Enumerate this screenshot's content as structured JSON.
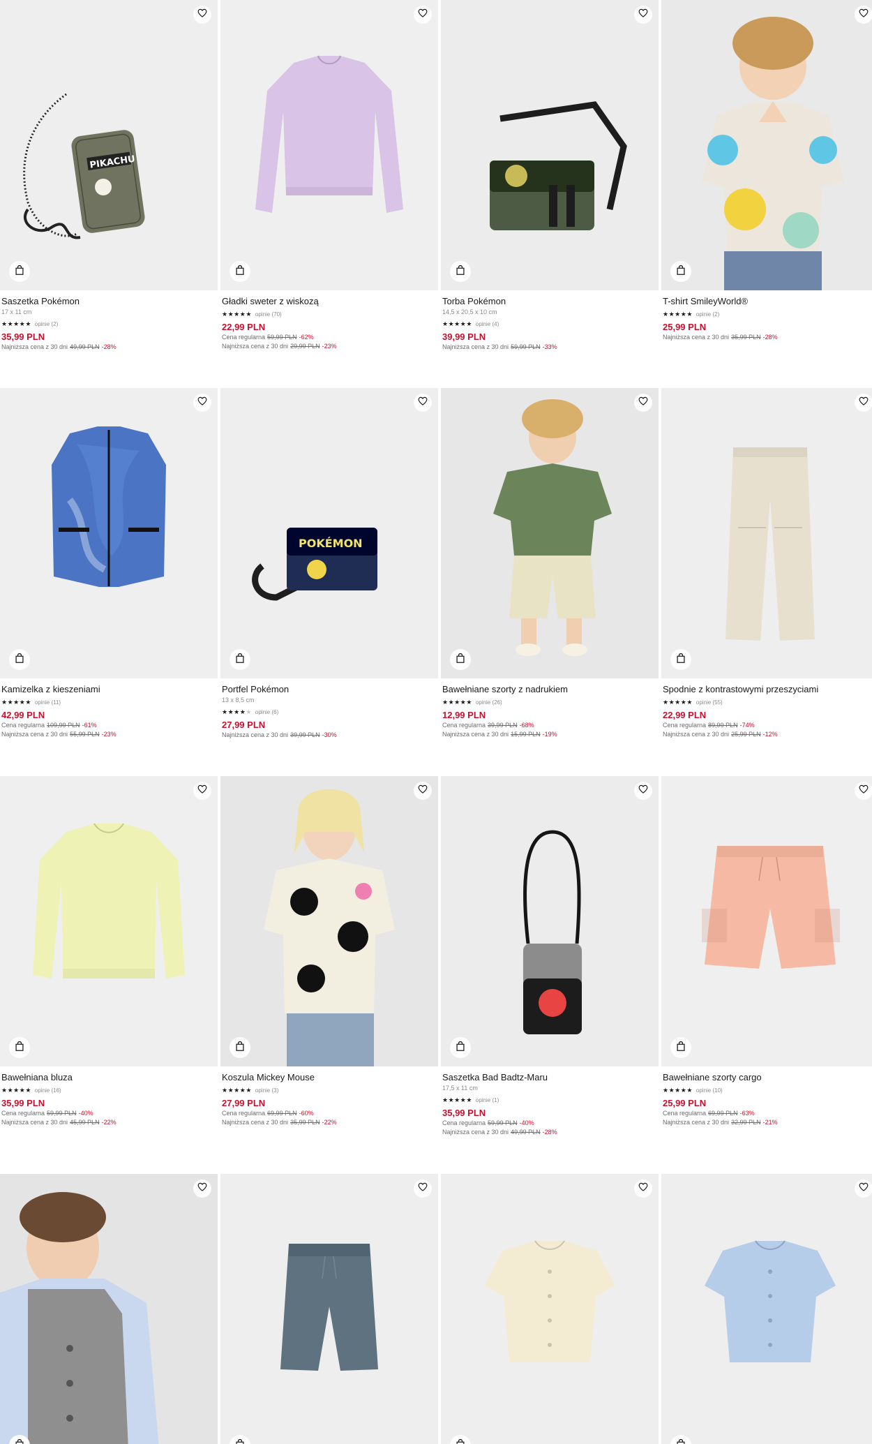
{
  "products": [
    {
      "name": "Saszetka Pokémon",
      "dims": "17 x 11 cm",
      "stars": 5,
      "reviews": "opinie (2)",
      "price": "35,99 PLN",
      "regular": null,
      "lowest": {
        "label": "Najniższa cena z 30 dni",
        "old": "49,99 PLN",
        "pct": "-28%"
      },
      "image": {
        "kind": "pouch",
        "bg": "#eeeeee",
        "color": "#6f735f"
      }
    },
    {
      "name": "Gładki sweter z wiskozą",
      "dims": "",
      "stars": 5,
      "reviews": "opinie (70)",
      "price": "22,99 PLN",
      "regular": {
        "label": "Cena regularna",
        "old": "59,99 PLN",
        "pct": "-62%"
      },
      "lowest": {
        "label": "Najniższa cena z 30 dni",
        "old": "29,99 PLN",
        "pct": "-23%"
      },
      "image": {
        "kind": "sweater",
        "bg": "#efefef",
        "color": "#d9c3e6"
      }
    },
    {
      "name": "Torba Pokémon",
      "dims": "14,5 x 20,5 x 10 cm",
      "stars": 4.5,
      "reviews": "opinie (4)",
      "price": "39,99 PLN",
      "regular": null,
      "lowest": {
        "label": "Najniższa cena z 30 dni",
        "old": "59,99 PLN",
        "pct": "-33%"
      },
      "image": {
        "kind": "messenger",
        "bg": "#ececec",
        "color": "#4d5a44"
      }
    },
    {
      "name": "T-shirt SmileyWorld®",
      "dims": "",
      "stars": 5,
      "reviews": "opinie (2)",
      "price": "25,99 PLN",
      "regular": null,
      "lowest": {
        "label": "Najniższa cena z 30 dni",
        "old": "35,99 PLN",
        "pct": "-28%"
      },
      "image": {
        "kind": "kid-tee",
        "bg": "#e6e6e6",
        "color": "#ece6dc"
      }
    },
    {
      "name": "Kamizelka z kieszeniami",
      "dims": "",
      "stars": 5,
      "reviews": "opinie (11)",
      "price": "42,99 PLN",
      "regular": {
        "label": "Cena regularna",
        "old": "109,99 PLN",
        "pct": "-61%"
      },
      "lowest": {
        "label": "Najniższa cena z 30 dni",
        "old": "55,99 PLN",
        "pct": "-23%"
      },
      "image": {
        "kind": "vest",
        "bg": "#efefef",
        "color": "#4b74c4"
      }
    },
    {
      "name": "Portfel Pokémon",
      "dims": "13 x 8,5 cm",
      "stars": 4,
      "reviews": "opinie (6)",
      "price": "27,99 PLN",
      "regular": null,
      "lowest": {
        "label": "Najniższa cena z 30 dni",
        "old": "39,99 PLN",
        "pct": "-30%"
      },
      "image": {
        "kind": "wallet",
        "bg": "#eeeeee",
        "color": "#1f2d55"
      }
    },
    {
      "name": "Bawełniane szorty z nadrukiem",
      "dims": "",
      "stars": 5,
      "reviews": "opinie (26)",
      "price": "12,99 PLN",
      "regular": {
        "label": "Cena regularna",
        "old": "39,99 PLN",
        "pct": "-68%"
      },
      "lowest": {
        "label": "Najniższa cena z 30 dni",
        "old": "15,99 PLN",
        "pct": "-19%"
      },
      "image": {
        "kind": "kid-shorts",
        "bg": "#e8e8e8",
        "color": "#6b8459"
      }
    },
    {
      "name": "Spodnie z kontrastowymi przeszyciami",
      "dims": "",
      "stars": 4.5,
      "reviews": "opinie (55)",
      "price": "22,99 PLN",
      "regular": {
        "label": "Cena regularna",
        "old": "89,99 PLN",
        "pct": "-74%"
      },
      "lowest": {
        "label": "Najniższa cena z 30 dni",
        "old": "25,99 PLN",
        "pct": "-12%"
      },
      "image": {
        "kind": "trousers",
        "bg": "#eeeeee",
        "color": "#e8e0cf"
      }
    },
    {
      "name": "Bawełniana bluza",
      "dims": "",
      "stars": 5,
      "reviews": "opinie (16)",
      "price": "35,99 PLN",
      "regular": {
        "label": "Cena regularna",
        "old": "59,99 PLN",
        "pct": "-40%"
      },
      "lowest": {
        "label": "Najniższa cena z 30 dni",
        "old": "45,99 PLN",
        "pct": "-22%"
      },
      "image": {
        "kind": "sweatshirt",
        "bg": "#efefef",
        "color": "#eef2b4"
      }
    },
    {
      "name": "Koszula Mickey Mouse",
      "dims": "",
      "stars": 5,
      "reviews": "opinie (3)",
      "price": "27,99 PLN",
      "regular": {
        "label": "Cena regularna",
        "old": "69,99 PLN",
        "pct": "-60%"
      },
      "lowest": {
        "label": "Najniższa cena z 30 dni",
        "old": "35,99 PLN",
        "pct": "-22%"
      },
      "image": {
        "kind": "kid-shirt",
        "bg": "#e8e8e8",
        "color": "#f2efe0"
      }
    },
    {
      "name": "Saszetka Bad Badtz-Maru",
      "dims": "17,5 x 11 cm",
      "stars": 5,
      "reviews": "opinie (1)",
      "price": "35,99 PLN",
      "regular": {
        "label": "Cena regularna",
        "old": "59,99 PLN",
        "pct": "-40%"
      },
      "lowest": {
        "label": "Najniższa cena z 30 dni",
        "old": "49,99 PLN",
        "pct": "-28%"
      },
      "image": {
        "kind": "crossbody",
        "bg": "#ececec",
        "color": "#8c8c8c"
      }
    },
    {
      "name": "Bawełniane szorty cargo",
      "dims": "",
      "stars": 5,
      "reviews": "opinie (10)",
      "price": "25,99 PLN",
      "regular": {
        "label": "Cena regularna",
        "old": "69,99 PLN",
        "pct": "-63%"
      },
      "lowest": {
        "label": "Najniższa cena z 30 dni",
        "old": "32,99 PLN",
        "pct": "-21%"
      },
      "image": {
        "kind": "cargo",
        "bg": "#efefef",
        "color": "#f6b9a3"
      }
    },
    {
      "name": "",
      "dims": "",
      "stars": null,
      "reviews": "",
      "price": "",
      "regular": null,
      "lowest": null,
      "image": {
        "kind": "kid-vest",
        "bg": "#e6e6e6",
        "color": "#8f8f8f"
      }
    },
    {
      "name": "",
      "dims": "",
      "stars": null,
      "reviews": "",
      "price": "",
      "regular": null,
      "lowest": null,
      "image": {
        "kind": "shorts",
        "bg": "#eeeeee",
        "color": "#5e7280"
      }
    },
    {
      "name": "",
      "dims": "",
      "stars": null,
      "reviews": "",
      "price": "",
      "regular": null,
      "lowest": null,
      "image": {
        "kind": "tee-buttons",
        "bg": "#eeeeee",
        "color": "#f4ecd2"
      }
    },
    {
      "name": "",
      "dims": "",
      "stars": null,
      "reviews": "",
      "price": "",
      "regular": null,
      "lowest": null,
      "image": {
        "kind": "tee-buttons",
        "bg": "#eeeeee",
        "color": "#b6cdea"
      }
    }
  ],
  "icons": {
    "wishlist": "heart-icon",
    "cart": "shopping-bag-icon"
  }
}
